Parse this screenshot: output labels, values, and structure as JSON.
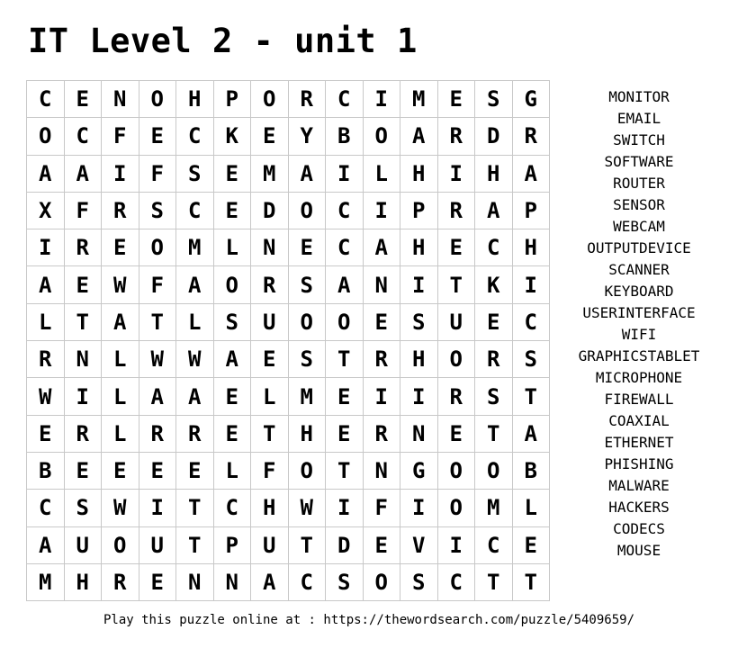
{
  "title": "IT Level 2 - unit 1",
  "grid": [
    [
      "C",
      "E",
      "N",
      "O",
      "H",
      "P",
      "O",
      "R",
      "C",
      "I",
      "M",
      "E",
      "S",
      "G"
    ],
    [
      "O",
      "C",
      "F",
      "E",
      "C",
      "K",
      "E",
      "Y",
      "B",
      "O",
      "A",
      "R",
      "D",
      "R"
    ],
    [
      "A",
      "A",
      "I",
      "F",
      "S",
      "E",
      "M",
      "A",
      "I",
      "L",
      "H",
      "I",
      "H",
      "A"
    ],
    [
      "X",
      "F",
      "R",
      "S",
      "C",
      "E",
      "D",
      "O",
      "C",
      "I",
      "P",
      "R",
      "A",
      "P"
    ],
    [
      "I",
      "R",
      "E",
      "O",
      "M",
      "L",
      "N",
      "E",
      "C",
      "A",
      "H",
      "E",
      "C",
      "H"
    ],
    [
      "A",
      "E",
      "W",
      "F",
      "A",
      "O",
      "R",
      "S",
      "A",
      "N",
      "I",
      "T",
      "K",
      "I"
    ],
    [
      "L",
      "T",
      "A",
      "T",
      "L",
      "S",
      "U",
      "O",
      "O",
      "E",
      "S",
      "U",
      "E",
      "C"
    ],
    [
      "R",
      "N",
      "L",
      "W",
      "W",
      "A",
      "E",
      "S",
      "T",
      "R",
      "H",
      "O",
      "R",
      "S"
    ],
    [
      "W",
      "I",
      "L",
      "A",
      "A",
      "E",
      "L",
      "M",
      "E",
      "I",
      "I",
      "R",
      "S",
      "T"
    ],
    [
      "E",
      "R",
      "L",
      "R",
      "R",
      "E",
      "T",
      "H",
      "E",
      "R",
      "N",
      "E",
      "T",
      "A"
    ],
    [
      "B",
      "E",
      "E",
      "E",
      "E",
      "L",
      "F",
      "O",
      "T",
      "N",
      "G",
      "O",
      "O",
      "B"
    ],
    [
      "C",
      "S",
      "W",
      "I",
      "T",
      "C",
      "H",
      "W",
      "I",
      "F",
      "I",
      "O",
      "M",
      "L"
    ],
    [
      "A",
      "U",
      "O",
      "U",
      "T",
      "P",
      "U",
      "T",
      "D",
      "E",
      "V",
      "I",
      "C",
      "E"
    ],
    [
      "M",
      "H",
      "R",
      "E",
      "N",
      "N",
      "A",
      "C",
      "S",
      "O",
      "S",
      "C",
      "T",
      "T"
    ]
  ],
  "words": [
    "MONITOR",
    "EMAIL",
    "SWITCH",
    "SOFTWARE",
    "ROUTER",
    "SENSOR",
    "WEBCAM",
    "OUTPUTDEVICE",
    "SCANNER",
    "KEYBOARD",
    "USERINTERFACE",
    "WIFI",
    "GRAPHICSTABLET",
    "MICROPHONE",
    "FIREWALL",
    "COAXIAL",
    "ETHERNET",
    "PHISHING",
    "MALWARE",
    "HACKERS",
    "CODECS",
    "MOUSE"
  ],
  "footer": "Play this puzzle online at : https://thewordsearch.com/puzzle/5409659/"
}
